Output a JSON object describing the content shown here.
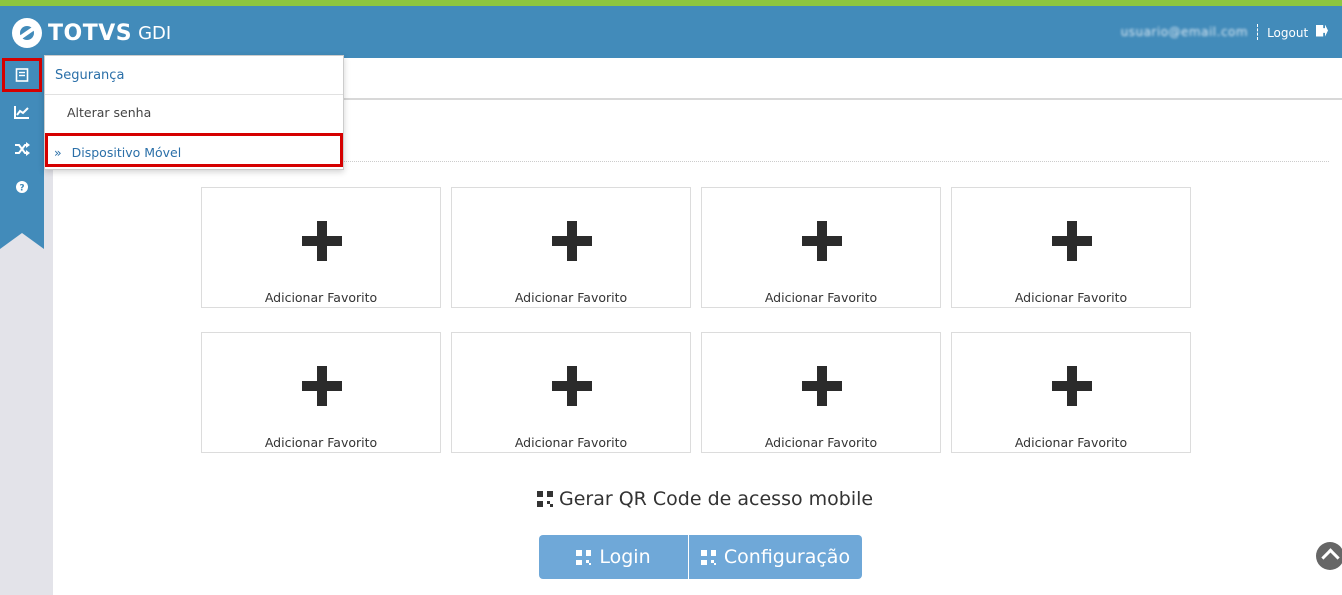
{
  "header": {
    "logo_text": "TOTVS",
    "logo_sub": "GDI",
    "user_email": "usuario@email.com",
    "logout_label": "Logout"
  },
  "sidebar": {
    "icons": [
      "notebook-icon",
      "chart-icon",
      "shuffle-icon",
      "help-icon"
    ]
  },
  "dropdown": {
    "title": "Segurança",
    "items": [
      {
        "label": "Alterar senha"
      },
      {
        "label": "Dispositivo Móvel",
        "prefix": "»"
      }
    ]
  },
  "favorites": [
    {
      "label": "Adicionar Favorito"
    },
    {
      "label": "Adicionar Favorito"
    },
    {
      "label": "Adicionar Favorito"
    },
    {
      "label": "Adicionar Favorito"
    },
    {
      "label": "Adicionar Favorito"
    },
    {
      "label": "Adicionar Favorito"
    },
    {
      "label": "Adicionar Favorito"
    },
    {
      "label": "Adicionar Favorito"
    }
  ],
  "qr": {
    "title": "Gerar QR Code de acesso mobile",
    "login_label": "Login",
    "config_label": "Configuração"
  },
  "colors": {
    "header": "#428bba",
    "accent": "#8dc63f",
    "highlight": "#d50000",
    "button": "#6fa8d8"
  }
}
